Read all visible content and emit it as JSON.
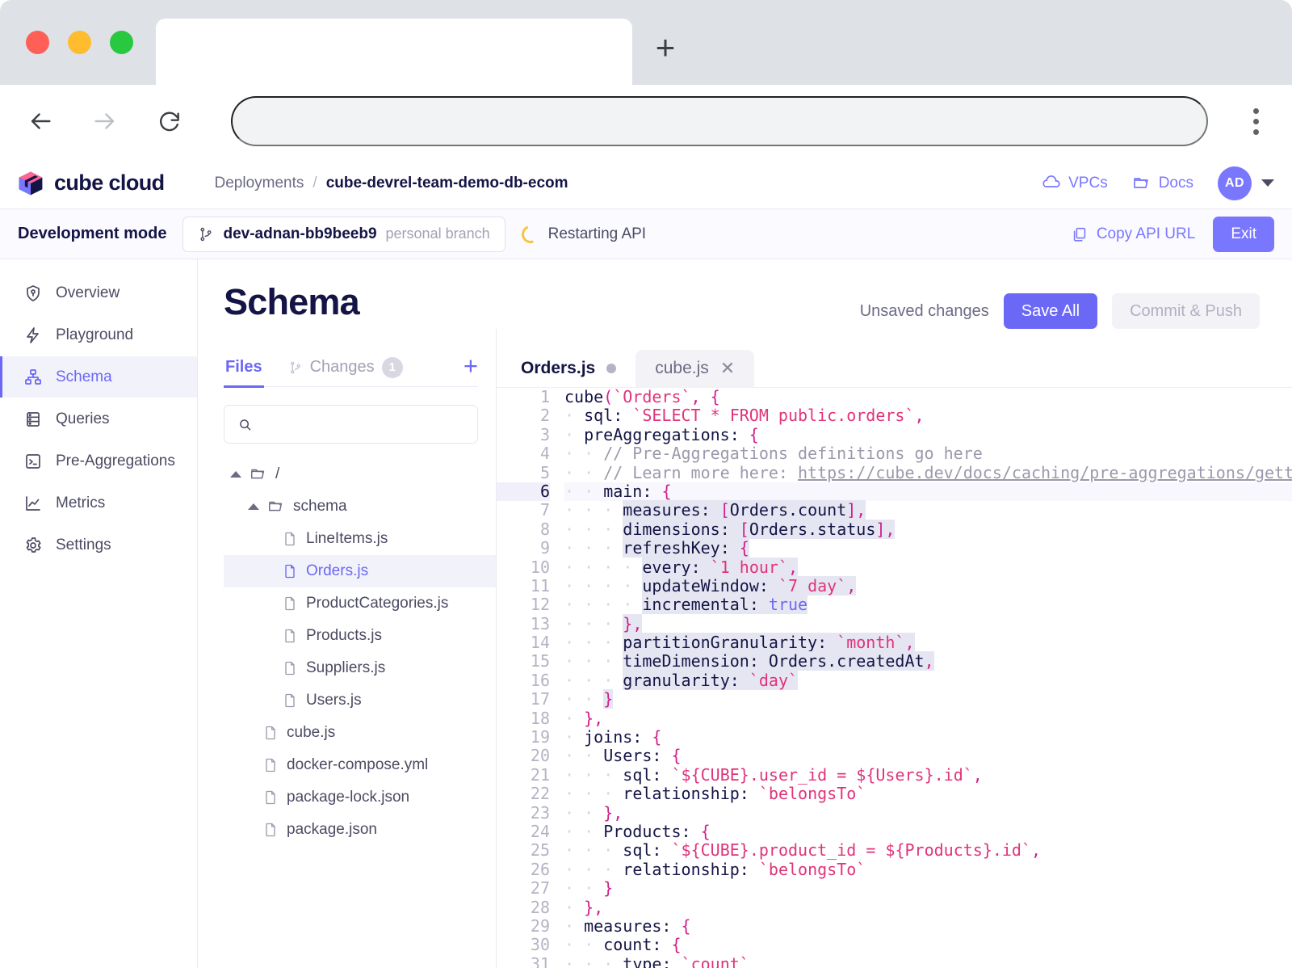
{
  "browser": {
    "tab_title": "",
    "address_value": "",
    "back_icon": "arrow-left-icon",
    "forward_icon": "arrow-right-icon",
    "reload_icon": "reload-icon",
    "new_tab_label": "+",
    "menu_icon": "kebab-menu-icon"
  },
  "header": {
    "logo_text": "cube cloud",
    "breadcrumb": {
      "root": "Deployments",
      "separator": "/",
      "current": "cube-devrel-team-demo-db-ecom"
    },
    "vpcs_label": "VPCs",
    "docs_label": "Docs",
    "avatar_initials": "AD"
  },
  "devbar": {
    "mode_label": "Development mode",
    "branch_name": "dev-adnan-bb9beeb9",
    "branch_sub": "personal branch",
    "status_text": "Restarting API",
    "copy_api_url_label": "Copy API URL",
    "exit_label": "Exit"
  },
  "sidebar": {
    "items": [
      {
        "label": "Overview",
        "icon": "shield-icon",
        "active": false
      },
      {
        "label": "Playground",
        "icon": "bolt-icon",
        "active": false
      },
      {
        "label": "Schema",
        "icon": "schema-icon",
        "active": true
      },
      {
        "label": "Queries",
        "icon": "database-icon",
        "active": false
      },
      {
        "label": "Pre-Aggregations",
        "icon": "terminal-icon",
        "active": false
      },
      {
        "label": "Metrics",
        "icon": "chart-line-icon",
        "active": false
      },
      {
        "label": "Settings",
        "icon": "gear-icon",
        "active": false
      }
    ]
  },
  "main": {
    "page_title": "Schema",
    "unsaved_label": "Unsaved changes",
    "save_all_label": "Save All",
    "commit_push_label": "Commit & Push"
  },
  "filepane": {
    "tabs": [
      {
        "label": "Files",
        "active": true,
        "badge": ""
      },
      {
        "label": "Changes",
        "active": false,
        "badge": "1",
        "icon": "branch-icon"
      }
    ],
    "add_label": "+",
    "search_placeholder": "",
    "search_value": "",
    "tree": [
      {
        "label": "/",
        "type": "folder",
        "depth": 0,
        "expanded": true,
        "selected": false
      },
      {
        "label": "schema",
        "type": "folder",
        "depth": 1,
        "expanded": true,
        "selected": false
      },
      {
        "label": "LineItems.js",
        "type": "file",
        "depth": 2,
        "selected": false
      },
      {
        "label": "Orders.js",
        "type": "file",
        "depth": 2,
        "selected": true
      },
      {
        "label": "ProductCategories.js",
        "type": "file",
        "depth": 2,
        "selected": false
      },
      {
        "label": "Products.js",
        "type": "file",
        "depth": 2,
        "selected": false
      },
      {
        "label": "Suppliers.js",
        "type": "file",
        "depth": 2,
        "selected": false
      },
      {
        "label": "Users.js",
        "type": "file",
        "depth": 2,
        "selected": false
      },
      {
        "label": "cube.js",
        "type": "file",
        "depth": 1,
        "selected": false
      },
      {
        "label": "docker-compose.yml",
        "type": "file",
        "depth": 1,
        "selected": false
      },
      {
        "label": "package-lock.json",
        "type": "file",
        "depth": 1,
        "selected": false
      },
      {
        "label": "package.json",
        "type": "file",
        "depth": 1,
        "selected": false
      }
    ]
  },
  "editor": {
    "tabs": [
      {
        "label": "Orders.js",
        "active": true,
        "modified": true
      },
      {
        "label": "cube.js",
        "active": false,
        "closable": true
      }
    ],
    "current_line": 6,
    "selection_lines": [
      7,
      8,
      9,
      10,
      11,
      12,
      13,
      14,
      15,
      16,
      17
    ],
    "lines": [
      {
        "n": 1,
        "text": "cube(`Orders`, {"
      },
      {
        "n": 2,
        "text": "  sql: `SELECT * FROM public.orders`,"
      },
      {
        "n": 3,
        "text": "  preAggregations: {"
      },
      {
        "n": 4,
        "text": "    // Pre-Aggregations definitions go here"
      },
      {
        "n": 5,
        "text": "    // Learn more here: https://cube.dev/docs/caching/pre-aggregations/getting-started"
      },
      {
        "n": 6,
        "text": "    main: {"
      },
      {
        "n": 7,
        "text": "      measures: [Orders.count],"
      },
      {
        "n": 8,
        "text": "      dimensions: [Orders.status],"
      },
      {
        "n": 9,
        "text": "      refreshKey: {"
      },
      {
        "n": 10,
        "text": "        every: `1 hour`,"
      },
      {
        "n": 11,
        "text": "        updateWindow: `7 day`,"
      },
      {
        "n": 12,
        "text": "        incremental: true"
      },
      {
        "n": 13,
        "text": "      },"
      },
      {
        "n": 14,
        "text": "      partitionGranularity: `month`,"
      },
      {
        "n": 15,
        "text": "      timeDimension: Orders.createdAt,"
      },
      {
        "n": 16,
        "text": "      granularity: `day`"
      },
      {
        "n": 17,
        "text": "    }"
      },
      {
        "n": 18,
        "text": "  },"
      },
      {
        "n": 19,
        "text": "  joins: {"
      },
      {
        "n": 20,
        "text": "    Users: {"
      },
      {
        "n": 21,
        "text": "      sql: `${CUBE}.user_id = ${Users}.id`,"
      },
      {
        "n": 22,
        "text": "      relationship: `belongsTo`"
      },
      {
        "n": 23,
        "text": "    },"
      },
      {
        "n": 24,
        "text": "    Products: {"
      },
      {
        "n": 25,
        "text": "      sql: `${CUBE}.product_id = ${Products}.id`,"
      },
      {
        "n": 26,
        "text": "      relationship: `belongsTo`"
      },
      {
        "n": 27,
        "text": "    }"
      },
      {
        "n": 28,
        "text": "  },"
      },
      {
        "n": 29,
        "text": "  measures: {"
      },
      {
        "n": 30,
        "text": "    count: {"
      },
      {
        "n": 31,
        "text": "      type: `count`"
      }
    ]
  },
  "colors": {
    "accent": "#6b68f5",
    "accent_light": "#7a77ff",
    "ink": "#141446",
    "muted": "#6b6b85",
    "string": "#e0337a",
    "comment": "#9b99ab",
    "selection": "#e6e6f2",
    "spinner": "#f5c542"
  }
}
